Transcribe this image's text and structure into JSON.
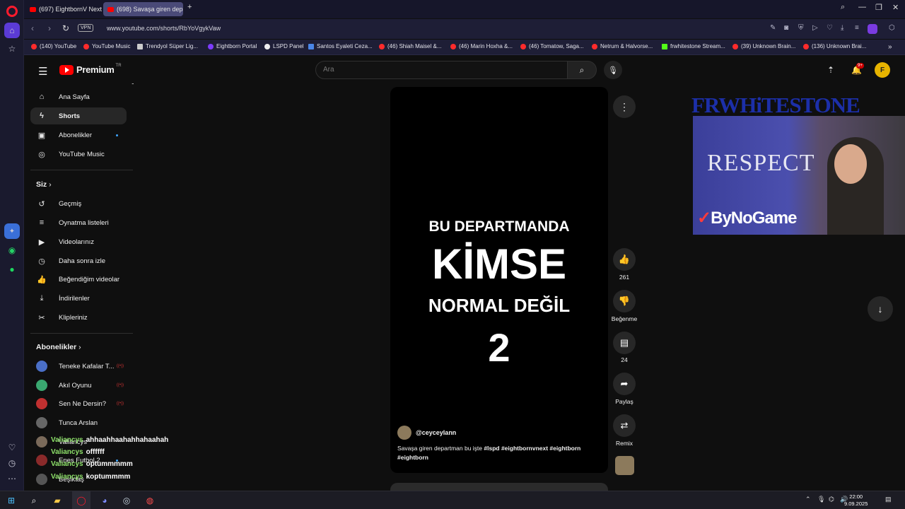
{
  "browser": {
    "tabs": [
      {
        "label": "(697) EightbornV Next - Y",
        "active": false
      },
      {
        "label": "(698) Savaşa giren depar…",
        "active": true
      }
    ],
    "url": "www.youtube.com/shorts/RbYoVgykVaw",
    "vpn_label": "VPN",
    "bookmarks": [
      "(140) YouTube",
      "YouTube Music",
      "Trendyol Süper Lig...",
      "Eightborn Portal",
      "LSPD Panel",
      "Santos Eyaleti Ceza...",
      "(46) Shiah Maisel &...",
      "(46) Marin Hoxha &...",
      "(46) Tomatow, Saga...",
      "Netrum & Halvorse...",
      "frwhitestone Stream...",
      "(39) Unknown Brain...",
      "(136) Unknown Brai..."
    ]
  },
  "youtube": {
    "logo_text": "Premium",
    "logo_country": "TR",
    "search_placeholder": "Ara",
    "notification_count": "9+",
    "avatar_letter": "F",
    "guide": {
      "main": [
        {
          "label": "Ana Sayfa",
          "icon": "home-icon"
        },
        {
          "label": "Shorts",
          "icon": "shorts-icon",
          "active": true
        },
        {
          "label": "Abonelikler",
          "icon": "subscriptions-icon"
        },
        {
          "label": "YouTube Music",
          "icon": "music-icon"
        }
      ],
      "you_title": "Siz",
      "you": [
        {
          "label": "Geçmiş",
          "icon": "history-icon"
        },
        {
          "label": "Oynatma listeleri",
          "icon": "playlist-icon"
        },
        {
          "label": "Videolarınız",
          "icon": "video-icon"
        },
        {
          "label": "Daha sonra izle",
          "icon": "clock-icon"
        },
        {
          "label": "Beğendiğim videolar",
          "icon": "thumb-up-icon"
        },
        {
          "label": "İndirilenler",
          "icon": "download-icon"
        },
        {
          "label": "Klipleriniz",
          "icon": "scissors-icon"
        }
      ],
      "subs_title": "Abonelikler",
      "subs": [
        {
          "label": "Teneke Kafalar T...",
          "color": "#4a6fc7",
          "live": true
        },
        {
          "label": "Akıl Oyunu",
          "color": "#3aa870",
          "live": true
        },
        {
          "label": "Sen Ne Dersin?",
          "color": "#c03030",
          "live": true
        },
        {
          "label": "Tunca Arslan",
          "color": "#666666",
          "live": false
        },
        {
          "label": "Valiancys",
          "color": "#7a6a5a",
          "live": false
        },
        {
          "label": "Enes Futbol 2",
          "color": "#8a2a2a",
          "live": false
        },
        {
          "label": "Beşiktaş",
          "color": "#555555",
          "live": false
        }
      ]
    },
    "short": {
      "line1": "BU DEPARTMANDA",
      "line2": "KİMSE",
      "line3": "NORMAL DEĞİL",
      "line4": "2",
      "channel": "@ceyceylann",
      "caption_plain": "Savaşa giren departman bu işte ",
      "caption_tags": "#lspd #eightbornvnext #eightborn",
      "caption_tags2": "#eightborn"
    },
    "actions": {
      "likes": "261",
      "dislike_label": "Beğenme",
      "comments": "24",
      "share_label": "Paylaş",
      "remix_label": "Remix"
    }
  },
  "stream_overlay": {
    "banner": "FRWHiTESTONE",
    "flag_text": "RESPECT",
    "brand_prefix": "✓",
    "brand": "ByNoGame",
    "chat": [
      {
        "nick": "Valiancys",
        "msg": "ahhaahhaahahhahaahah"
      },
      {
        "nick": "Valiancys",
        "msg": "offffff"
      },
      {
        "nick": "Valiancys",
        "msg": "optummmmm"
      },
      {
        "nick": "Valiancys",
        "msg": "koptummmm"
      }
    ]
  },
  "taskbar": {
    "time": "22:00",
    "date": "9.09.2025"
  }
}
